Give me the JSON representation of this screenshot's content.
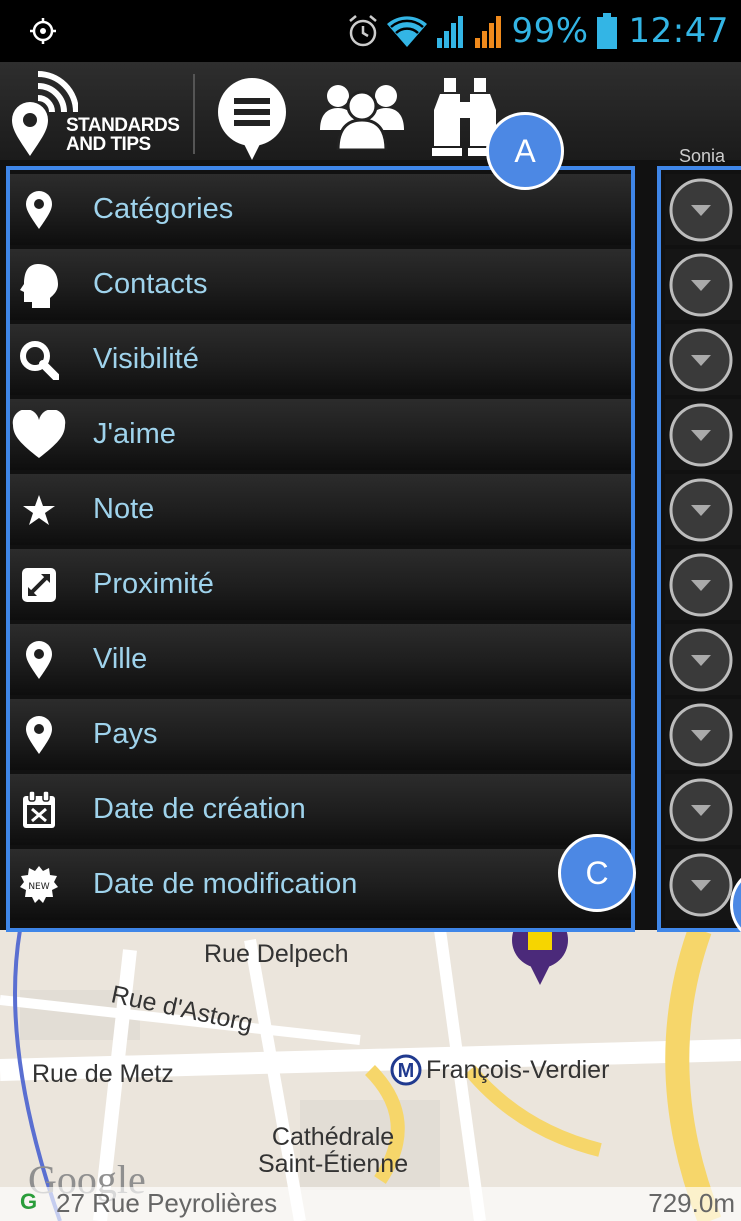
{
  "status_bar": {
    "battery_percent": "99%",
    "time": "12:47",
    "icons": [
      "gps-icon",
      "alarm-icon",
      "wifi-icon",
      "signal-icon",
      "signal-icon-2",
      "battery-icon"
    ]
  },
  "toolbar": {
    "logo_line1": "STANDARDS",
    "logo_line2": "AND TIPS",
    "icons": [
      "chat-icon",
      "group-icon",
      "binoculars-icon"
    ],
    "user_label": "Sonia"
  },
  "sort_list": {
    "items": [
      {
        "label": "Catégories",
        "icon": "map-pin-icon"
      },
      {
        "label": "Contacts",
        "icon": "head-icon"
      },
      {
        "label": "Visibilité",
        "icon": "search-icon"
      },
      {
        "label": "J'aime",
        "icon": "heart-icon"
      },
      {
        "label": "Note",
        "icon": "star-icon"
      },
      {
        "label": "Proximité",
        "icon": "expand-icon"
      },
      {
        "label": "Ville",
        "icon": "map-pin-icon"
      },
      {
        "label": "Pays",
        "icon": "map-pin-icon"
      },
      {
        "label": "Date de création",
        "icon": "calendar-icon"
      },
      {
        "label": "Date de modification",
        "icon": "new-badge-icon"
      }
    ]
  },
  "callouts": {
    "a": "A",
    "c": "C"
  },
  "map": {
    "labels": {
      "rue_delpech": "Rue Delpech",
      "rue_astorg": "Rue d'Astorg",
      "rue_metz": "Rue de Metz",
      "metro": "François-Verdier",
      "cathedral_line1": "Cathédrale",
      "cathedral_line2": "Saint-Étienne",
      "google": "Google"
    },
    "bottom_bar": {
      "prefix": "G",
      "address": "27 Rue Peyrolières",
      "distance": "729.0m"
    }
  },
  "colors": {
    "accent": "#33b5e5",
    "label_blue": "#9fd3ec",
    "callout": "#4c88e4"
  }
}
